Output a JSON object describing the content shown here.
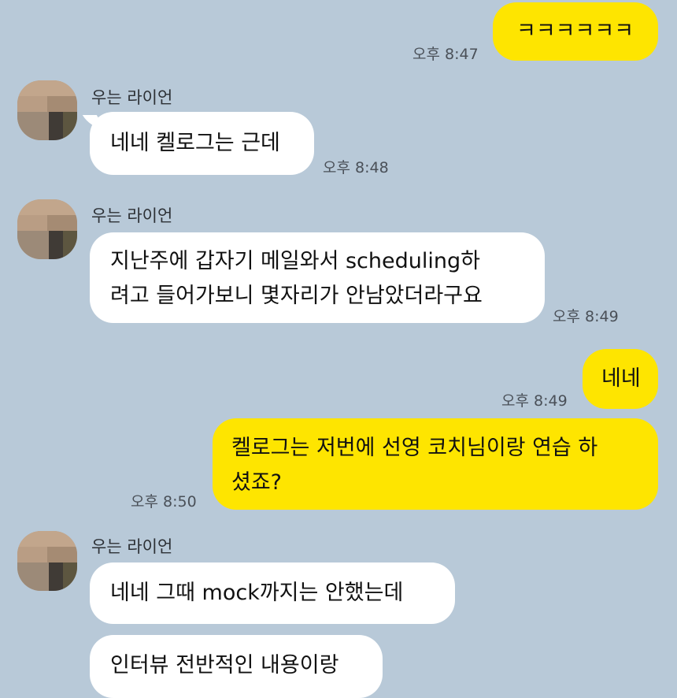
{
  "sender_name": "우는 라이언",
  "messages": [
    {
      "side": "out",
      "text": "ㅋㅋㅋㅋㅋㅋ",
      "time": "오후 8:47"
    },
    {
      "side": "in",
      "text": "네네 켈로그는 근데",
      "time": "오후 8:48"
    },
    {
      "side": "in",
      "lines": [
        "지난주에 갑자기 메일와서 scheduling하",
        "려고 들어가보니 몇자리가 안남았더라구요"
      ],
      "time": "오후 8:49"
    },
    {
      "side": "out",
      "text": "네네",
      "time": "오후 8:49"
    },
    {
      "side": "out",
      "lines": [
        "켈로그는 저번에 선영 코치님이랑 연습 하",
        "셨죠?"
      ],
      "time": "오후 8:50"
    },
    {
      "side": "in",
      "text": "네네 그때 mock까지는 안했는데"
    },
    {
      "side": "in",
      "text": "인터뷰 전반적인 내용이랑"
    }
  ],
  "colors": {
    "background": "#b8c9d8",
    "outgoing_bubble": "#fee500",
    "incoming_bubble": "#ffffff"
  },
  "icons": {
    "avatar": "pixelated-profile-avatar"
  }
}
